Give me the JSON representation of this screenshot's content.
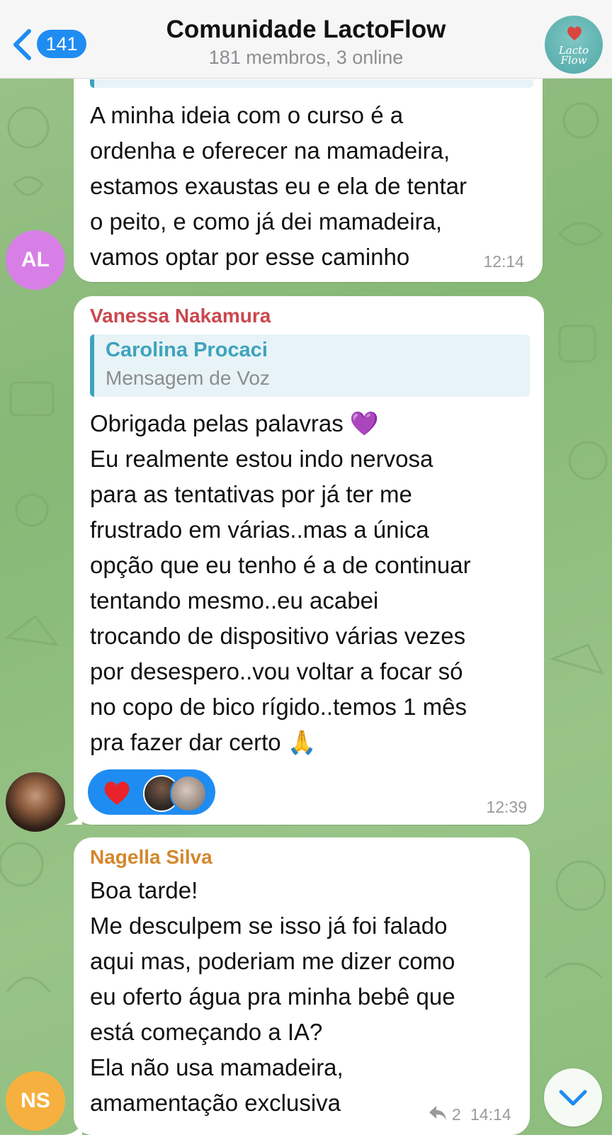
{
  "header": {
    "back_badge": "141",
    "title": "Comunidade LactoFlow",
    "subtitle": "181 membros, 3 online",
    "avatar_logo": "Lacto\nFlow"
  },
  "messages": [
    {
      "avatar_initials": "AL",
      "avatar_color": "#d77fe6",
      "text": "A minha ideia com o curso é a\nordenha e oferecer na mamadeira,\nestamos exaustas eu e ela de tentar\no peito, e como já dei mamadeira,\nvamos optar por esse caminho",
      "time": "12:14"
    },
    {
      "sender": "Vanessa Nakamura",
      "sender_color": "#c9484e",
      "reply_to": {
        "name": "Carolina Procaci",
        "text": "Mensagem de Voz"
      },
      "text": "Obrigada pelas palavras 💜\nEu realmente estou indo nervosa\npara as tentativas por já ter me\nfrustrado em várias..mas a única\nopção que eu tenho é a de continuar\ntentando mesmo..eu acabei\ntrocando de dispositivo várias vezes\npor desespero..vou voltar a focar só\nno copo de bico rígido..temos 1 mês\npra fazer dar certo 🙏",
      "reactions": [
        "heart-reaction",
        "reactor-avatar-1",
        "reactor-avatar-2"
      ],
      "time": "12:39"
    },
    {
      "sender": "Nagella Silva",
      "sender_color": "#d4872c",
      "avatar_initials": "NS",
      "avatar_color": "#f6b040",
      "text": "Boa tarde!\nMe desculpem se isso já foi falado\naqui mas, poderiam me dizer como\neu oferto água pra minha bebê que\nestá começando a IA?\nEla não usa mamadeira,\namamentação exclusiva",
      "replies_count": "2",
      "time": "14:14"
    }
  ],
  "colors": {
    "accent": "#1f8cf2",
    "header_bg": "#f6f6f6",
    "chat_bg": "#8fbd7f"
  }
}
